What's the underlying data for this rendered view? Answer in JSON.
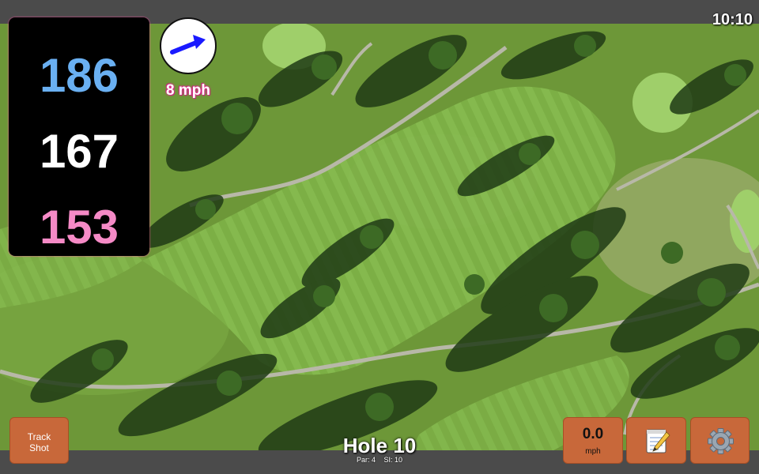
{
  "clock": "10:10",
  "distances": {
    "back": "186",
    "middle": "167",
    "front": "153"
  },
  "wind": {
    "speed": "8 mph",
    "direction_icon": "arrow-icon",
    "arrow_color": "#1a1aff"
  },
  "buttons": {
    "track_shot": {
      "line1": "Track",
      "line2": "Shot"
    },
    "speed": {
      "value": "0.0",
      "unit": "mph"
    },
    "notes_icon": "notepad-icon",
    "settings_icon": "gear-icon"
  },
  "hole": {
    "title": "Hole 10",
    "par": "Par: 4",
    "si": "SI: 10"
  },
  "colors": {
    "back": "#6ab0f2",
    "middle": "#ffffff",
    "front": "#f58ac6",
    "button": "#c8683a",
    "fairway": "#7fb54a",
    "rough": "#6f9a3c"
  }
}
